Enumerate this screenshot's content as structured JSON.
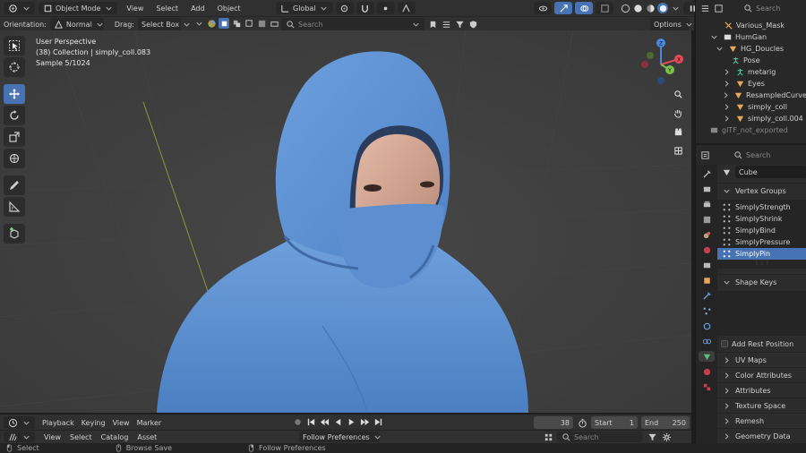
{
  "top_header": {
    "mode": "Object Mode",
    "menus": [
      "View",
      "Select",
      "Add",
      "Object"
    ],
    "transform_orientation": "Global"
  },
  "tool_header": {
    "orientation_label": "Orientation:",
    "orientation_value": "Normal",
    "drag_label": "Drag:",
    "drag_value": "Select Box",
    "search_placeholder": "Search",
    "options_label": "Options"
  },
  "viewport": {
    "perspective": "User Perspective",
    "collection": "(38) Collection | simply_coll.083",
    "sample": "Sample 5/1024",
    "gizmo_axes": {
      "x": "X",
      "y": "Y",
      "z": "Z"
    }
  },
  "outliner": {
    "search_placeholder": "Search",
    "items": [
      {
        "label": "Various_Mask",
        "icon": "modifier-wrench-icon",
        "indent": 0
      },
      {
        "label": "HumGan",
        "icon": "collection-icon",
        "indent": 0
      },
      {
        "label": "HG_Doucles",
        "icon": "mesh-triangle-icon",
        "indent": 1
      },
      {
        "label": "Pose",
        "icon": "armature-icon",
        "indent": 2
      },
      {
        "label": "metarig",
        "icon": "armature-icon",
        "indent": 2
      },
      {
        "label": "Eyes",
        "icon": "mesh-triangle-icon",
        "indent": 2
      },
      {
        "label": "ResampledCurveOb",
        "icon": "mesh-triangle-icon",
        "indent": 2
      },
      {
        "label": "simply_coll",
        "icon": "mesh-triangle-icon",
        "indent": 2
      },
      {
        "label": "simply_coll.004",
        "icon": "mesh-triangle-icon",
        "indent": 2
      },
      {
        "label": "glTF_not_exported",
        "icon": "collection-icon",
        "indent": 0
      }
    ]
  },
  "properties": {
    "search_placeholder": "Search",
    "object_name": "Cube",
    "vertex_groups_title": "Vertex Groups",
    "vertex_groups": [
      "SimplyStrength",
      "SimplyShrink",
      "SimplyBind",
      "SimplyPressure",
      "SimplyPin"
    ],
    "selected_vertex_group": "SimplyPin",
    "shape_keys_title": "Shape Keys",
    "add_rest_position": "Add Rest Position",
    "panels": [
      "UV Maps",
      "Color Attributes",
      "Attributes",
      "Texture Space",
      "Remesh",
      "Geometry Data"
    ]
  },
  "timeline": {
    "menus": [
      "Playback",
      "Keying",
      "View",
      "Marker"
    ],
    "current_frame": "38",
    "start_label": "Start",
    "start_value": "1",
    "end_label": "End",
    "end_value": "250"
  },
  "filebrowser": {
    "menus": [
      "View",
      "Select",
      "Catalog",
      "Asset"
    ],
    "import_method": "Follow Preferences",
    "search_placeholder": "Search"
  },
  "statusbar": {
    "items": [
      "Select",
      "Browse Save",
      "Follow Preferences"
    ]
  },
  "colors": {
    "accent": "#4772b3",
    "viewport_bg": "#3d3d3d",
    "panel_bg": "#282828",
    "hoodie": "#5b8fd0"
  }
}
